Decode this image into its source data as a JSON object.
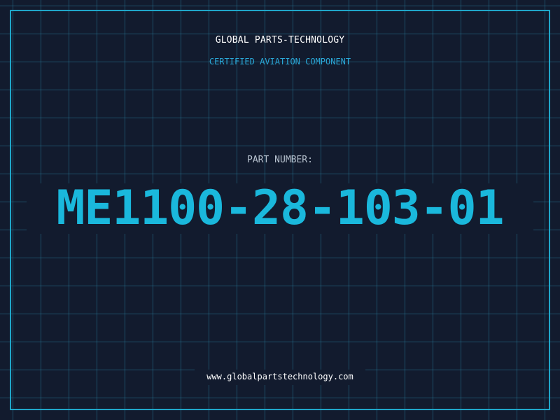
{
  "header": {
    "brand": "GLOBAL PARTS-TECHNOLOGY",
    "subtitle": "CERTIFIED AVIATION COMPONENT"
  },
  "part": {
    "label": "PART NUMBER:",
    "number": "ME1100-28-103-01"
  },
  "footer": {
    "url": "www.globalpartstechnology.com"
  },
  "colors": {
    "background": "#121b2e",
    "accent": "#1ab8dc",
    "frame": "#1fa6c9",
    "grid": "#287896"
  }
}
